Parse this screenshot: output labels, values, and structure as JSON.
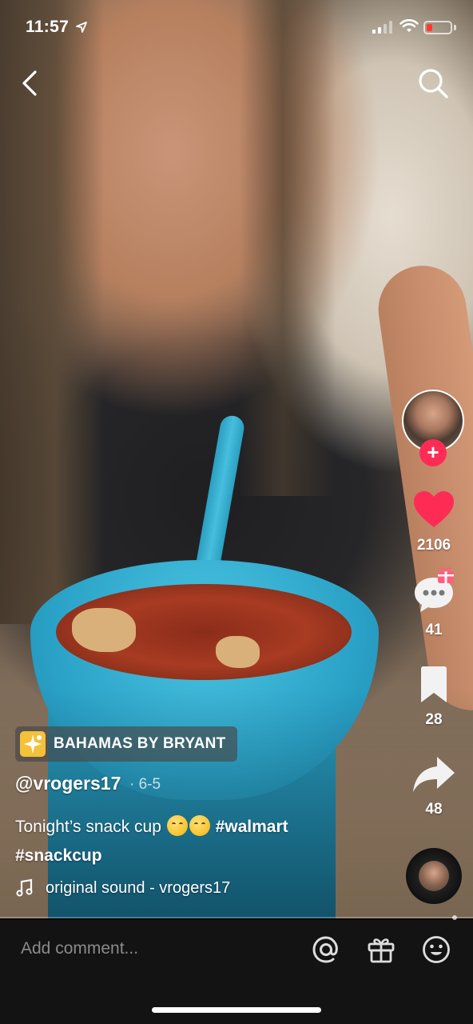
{
  "status_bar": {
    "time": "11:57",
    "battery_color": "#ff3b30"
  },
  "top_nav": {
    "back_icon": "chevron-left-icon",
    "search_icon": "search-icon"
  },
  "side_actions": {
    "likes": "2106",
    "comments": "41",
    "bookmarks": "28",
    "shares": "48",
    "like_color": "#fe2c55",
    "follow_color": "#fe2c55"
  },
  "post": {
    "effect_label": "BAHAMAS BY BRYANT",
    "username": "@vrogers17",
    "date": "· 6-5",
    "caption_text": "Tonight’s snack cup",
    "hashtag_1": "#walmart",
    "hashtag_2": "#snackcup",
    "sound": "original sound - vrogers17"
  },
  "comment_bar": {
    "placeholder": "Add comment...",
    "icons": [
      "at-icon",
      "gift-icon",
      "emoji-icon"
    ]
  }
}
